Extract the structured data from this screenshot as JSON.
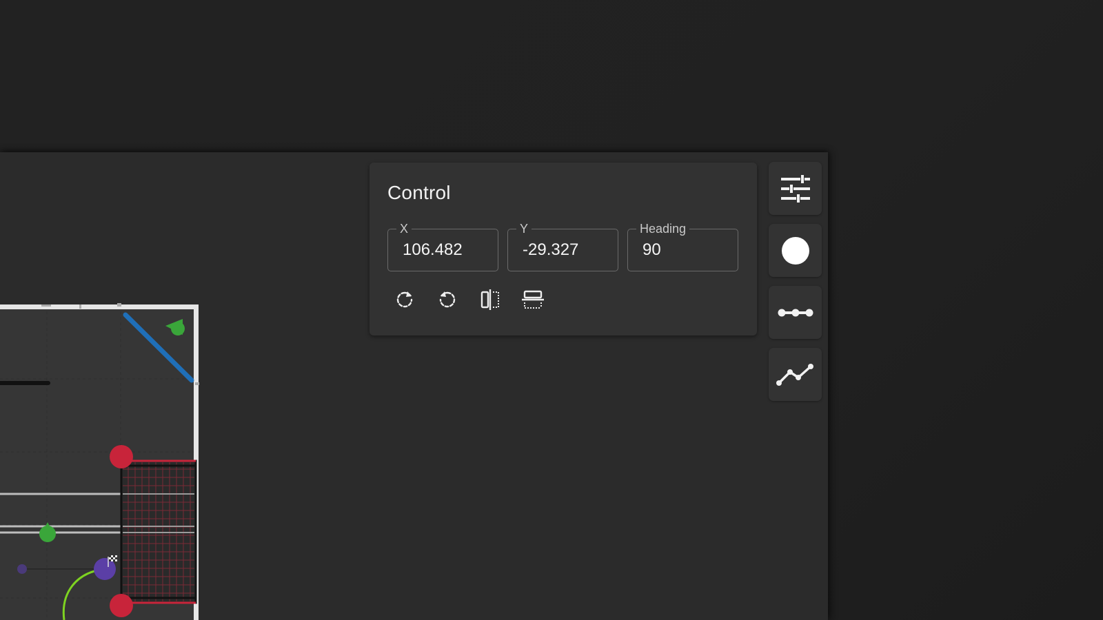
{
  "control": {
    "title": "Control",
    "x": {
      "label": "X",
      "value": "106.482"
    },
    "y": {
      "label": "Y",
      "value": "-29.327"
    },
    "heading": {
      "label": "Heading",
      "value": "90"
    }
  },
  "toolbar_actions": [
    {
      "icon": "rotate-clockwise-icon"
    },
    {
      "icon": "rotate-counterclockwise-icon"
    },
    {
      "icon": "flip-horizontal-icon"
    },
    {
      "icon": "flip-vertical-icon"
    }
  ],
  "side_toolbar": [
    {
      "icon": "sliders-icon"
    },
    {
      "icon": "circle-point-icon"
    },
    {
      "icon": "line-segment-icon"
    },
    {
      "icon": "path-icon"
    }
  ],
  "colors": {
    "background": "#222222",
    "panel": "#323232",
    "field_floor": "#3a3a3a",
    "alliance_red": "#c8243a",
    "alliance_blue": "#1f6fb8",
    "cone_green": "#3aa63a",
    "robot_purple": "#5b3fa6",
    "path_green": "#7ed321"
  }
}
